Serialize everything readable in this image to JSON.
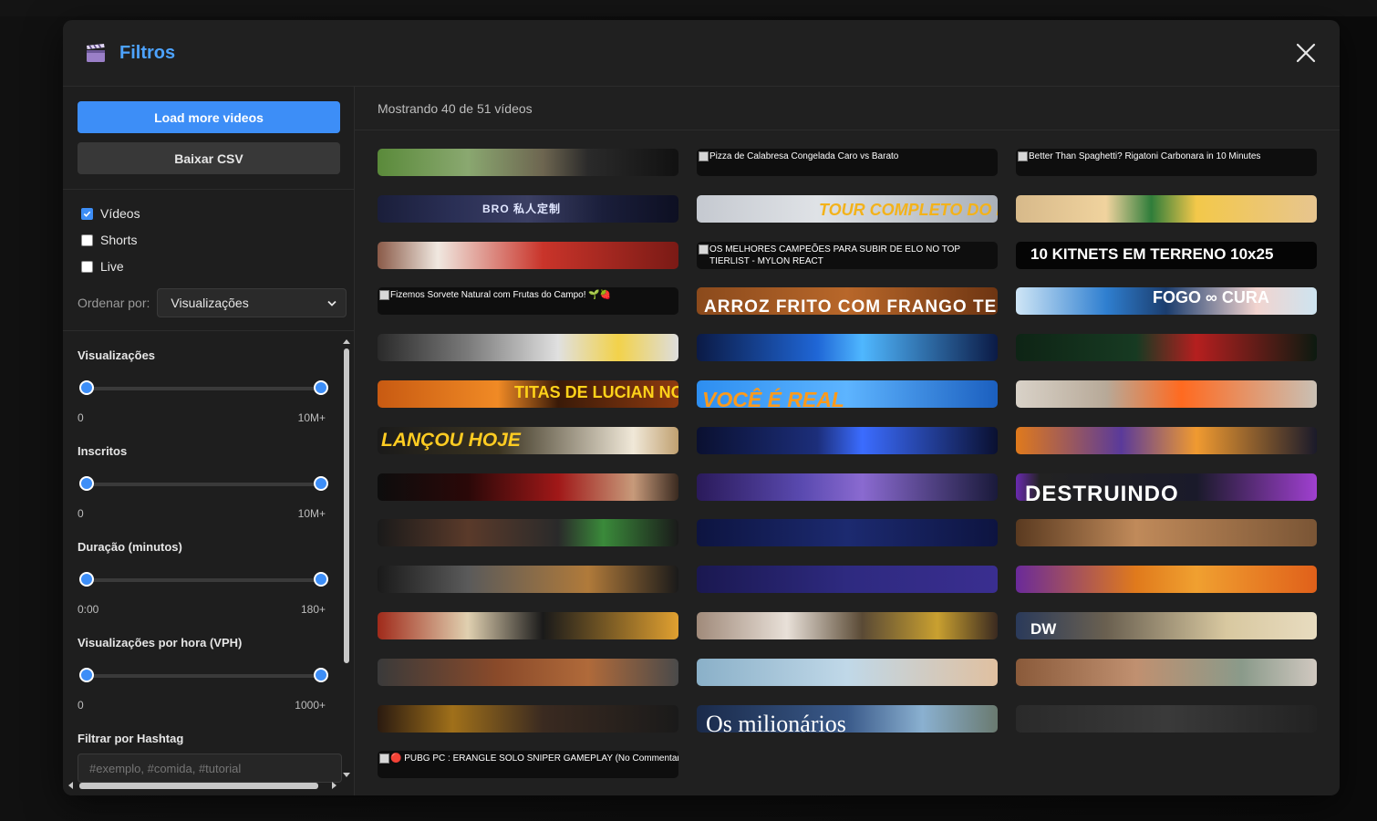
{
  "modal": {
    "title": "Filtros"
  },
  "sidebar": {
    "load_more_label": "Load more videos",
    "csv_label": "Baixar CSV",
    "types": [
      {
        "label": "Vídeos",
        "checked": true
      },
      {
        "label": "Shorts",
        "checked": false
      },
      {
        "label": "Live",
        "checked": false
      }
    ],
    "order_label": "Ordenar por:",
    "order_value": "Visualizações",
    "filters": [
      {
        "title": "Visualizações",
        "min": "0",
        "max": "10M+"
      },
      {
        "title": "Inscritos",
        "min": "0",
        "max": "10M+"
      },
      {
        "title": "Duração (minutos)",
        "min": "0:00",
        "max": "180+"
      },
      {
        "title": "Visualizações por hora (VPH)",
        "min": "0",
        "max": "1000+"
      }
    ],
    "hashtag_title": "Filtrar por Hashtag",
    "hashtag_placeholder": "#exemplo, #comida, #tutorial"
  },
  "content": {
    "status": "Mostrando 40 de 51 vídeos"
  },
  "videos": [
    {
      "thumb_text": "",
      "alt": "",
      "theme": "outdoor-green"
    },
    {
      "thumb_text": "",
      "alt": "Pizza de Calabresa Congelada Caro vs Barato",
      "theme": "dark"
    },
    {
      "thumb_text": "",
      "alt": "Better Than Spaghetti? Rigatoni Carbonara in 10 Minutes",
      "theme": "dark"
    },
    {
      "thumb_text": "BRO 私人定制",
      "alt": "",
      "theme": "navy"
    },
    {
      "thumb_text": "TOUR COMPLETO DO NOSSO",
      "alt": "",
      "theme": "sky-grey"
    },
    {
      "thumb_text": "",
      "alt": "",
      "theme": "cartoon"
    },
    {
      "thumb_text": "",
      "alt": "",
      "theme": "red-feather"
    },
    {
      "thumb_text": "",
      "alt": "OS MELHORES CAMPEÕES PARA SUBIR DE ELO NO TOP TIERLIST - MYLON REACT",
      "theme": "dark"
    },
    {
      "thumb_text": "10 KITNETS EM TERRENO 10x25",
      "alt": "",
      "theme": "black-title"
    },
    {
      "thumb_text": "",
      "alt": "Fizemos Sorvete Natural com Frutas do Campo! 🌱🍓",
      "theme": "dark"
    },
    {
      "thumb_text": "ARROZ FRITO COM FRANGO TERIYAKI",
      "alt": "",
      "theme": "wood"
    },
    {
      "thumb_text": "FOGO ∞ CURA",
      "alt": "",
      "theme": "anime-blue"
    },
    {
      "thumb_text": "",
      "alt": "",
      "theme": "kitchen-grey"
    },
    {
      "thumb_text": "",
      "alt": "",
      "theme": "blue-laser"
    },
    {
      "thumb_text": "",
      "alt": "",
      "theme": "dark-green-red"
    },
    {
      "thumb_text": "TITAS DE LUCIAN NO INHOUSE!",
      "alt": "",
      "theme": "orange-fire"
    },
    {
      "thumb_text": "VOCÊ É REAL",
      "alt": "",
      "theme": "sky-blue"
    },
    {
      "thumb_text": "",
      "alt": "",
      "theme": "room-orange"
    },
    {
      "thumb_text": "LANÇOU HOJE",
      "alt": "",
      "theme": "dark-yellow"
    },
    {
      "thumb_text": "",
      "alt": "",
      "theme": "steam-blue"
    },
    {
      "thumb_text": "",
      "alt": "",
      "theme": "orange-fighters"
    },
    {
      "thumb_text": "",
      "alt": "",
      "theme": "red-dark"
    },
    {
      "thumb_text": "",
      "alt": "",
      "theme": "purple-game"
    },
    {
      "thumb_text": "DESTRUINDO",
      "alt": "",
      "theme": "purple-frame"
    },
    {
      "thumb_text": "",
      "alt": "",
      "theme": "dark-face-green"
    },
    {
      "thumb_text": "",
      "alt": "",
      "theme": "night-stars"
    },
    {
      "thumb_text": "",
      "alt": "",
      "theme": "brown-table"
    },
    {
      "thumb_text": "",
      "alt": "",
      "theme": "dark-cooking"
    },
    {
      "thumb_text": "",
      "alt": "",
      "theme": "indigo-stars"
    },
    {
      "thumb_text": "",
      "alt": "",
      "theme": "orange-anime"
    },
    {
      "thumb_text": "",
      "alt": "",
      "theme": "red-yellow"
    },
    {
      "thumb_text": "",
      "alt": "",
      "theme": "food-plate"
    },
    {
      "thumb_text": "DW",
      "alt": "",
      "theme": "dw-beige"
    },
    {
      "thumb_text": "",
      "alt": "",
      "theme": "grey-wood"
    },
    {
      "thumb_text": "",
      "alt": "",
      "theme": "blue-rack"
    },
    {
      "thumb_text": "",
      "alt": "",
      "theme": "desert"
    },
    {
      "thumb_text": "",
      "alt": "",
      "theme": "dark-food"
    },
    {
      "thumb_text": "Os milionários",
      "alt": "",
      "theme": "coast"
    },
    {
      "thumb_text": "",
      "alt": "",
      "theme": "grey-blurred"
    },
    {
      "thumb_text": "",
      "alt": "🔴 PUBG PC : ERANGLE SOLO SNIPER GAMEPLAY (No Commentary)",
      "theme": "dark"
    }
  ]
}
